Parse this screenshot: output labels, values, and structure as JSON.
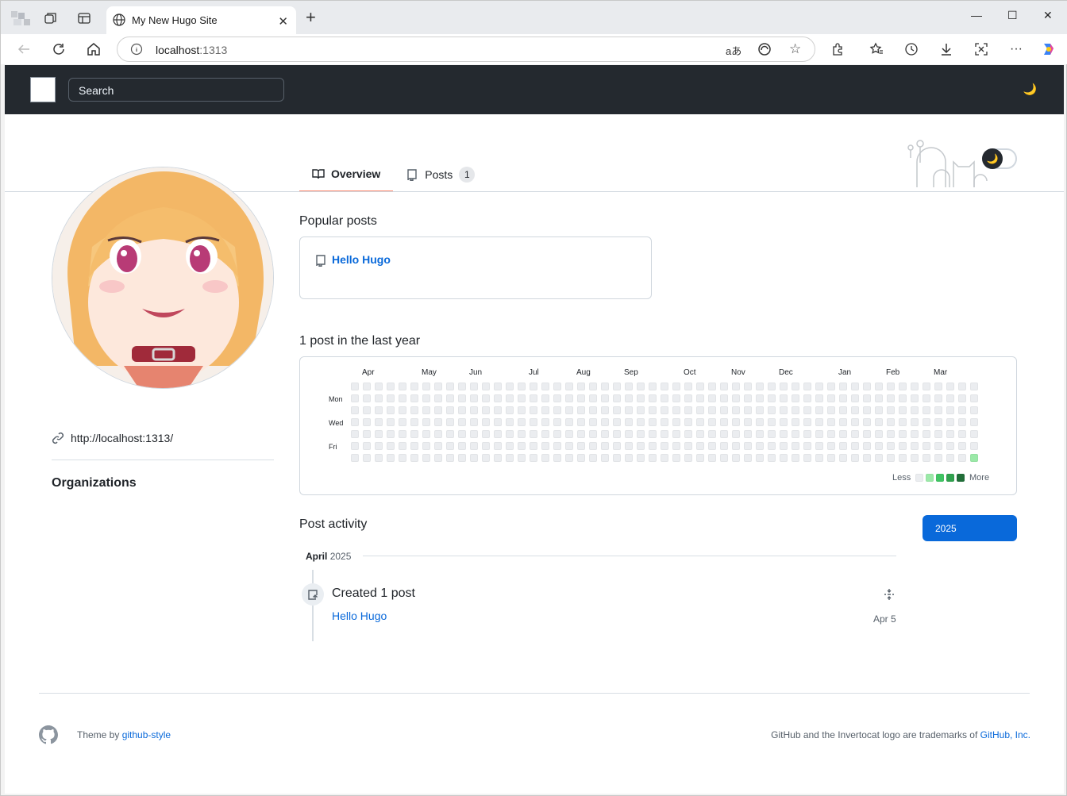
{
  "browser": {
    "tab_title": "My New Hugo Site",
    "url_host": "localhost",
    "url_port": ":1313"
  },
  "site": {
    "search_placeholder": "Search"
  },
  "tabs": [
    {
      "label": "Overview"
    },
    {
      "label": "Posts",
      "count": "1"
    }
  ],
  "profile": {
    "link": "http://localhost:1313/",
    "orgs_heading": "Organizations"
  },
  "popular": {
    "heading": "Popular posts",
    "items": [
      "Hello Hugo"
    ]
  },
  "contrib": {
    "heading": "1 post in the last year",
    "months": [
      "Apr",
      "May",
      "Jun",
      "Jul",
      "Aug",
      "Sep",
      "Oct",
      "Nov",
      "Dec",
      "Jan",
      "Feb",
      "Mar"
    ],
    "days": [
      "Mon",
      "Wed",
      "Fri"
    ],
    "legend_less": "Less",
    "legend_more": "More",
    "colors": [
      "#ebedf0",
      "#9be9a8",
      "#40c463",
      "#30a14e",
      "#216e39"
    ]
  },
  "activity": {
    "heading": "Post activity",
    "year_button": "2025",
    "month": "April",
    "month_year": "2025",
    "title": "Created 1 post",
    "post": "Hello Hugo",
    "date": "Apr 5"
  },
  "footer": {
    "theme_by": "Theme by ",
    "theme_link": "github-style",
    "trademark": "GitHub and the Invertocat logo are trademarks of ",
    "company": "GitHub, Inc."
  }
}
